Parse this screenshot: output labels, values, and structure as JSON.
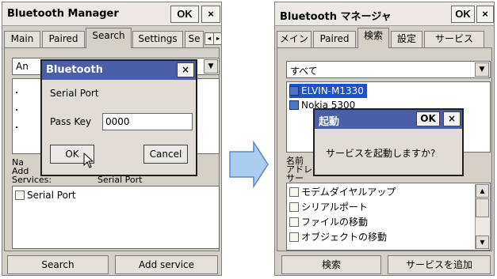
{
  "left": {
    "title": "Bluetooth Manager",
    "ok": "OK",
    "close": "×",
    "tabs": [
      "Main",
      "Paired",
      "Search",
      "Settings",
      "Se"
    ],
    "tab_scroll": [
      "◂",
      "▸"
    ],
    "filter_value": "An",
    "devices_hidden": true,
    "info": {
      "name_label": "Na",
      "address_label": "Add",
      "services_label": "Services:",
      "services_value": "Serial Port"
    },
    "services": [
      "Serial Port"
    ],
    "search_button": "Search",
    "add_service_button": "Add service",
    "dialog": {
      "title": "Bluetooth",
      "close": "×",
      "service": "Serial Port",
      "passkey_label": "Pass Key",
      "passkey_value": "0000",
      "ok": "OK",
      "cancel": "Cancel"
    }
  },
  "right": {
    "title": "Bluetooth マネージャ",
    "ok": "OK",
    "close": "×",
    "tabs": [
      "メイン",
      "Paired",
      "検索",
      "設定",
      "サービス"
    ],
    "filter_value": "すべて",
    "devices": [
      "ELVIN-M1330",
      "Nokia 5300"
    ],
    "info": {
      "name_label": "名前",
      "address_label": "アドレ",
      "services_label": "サー"
    },
    "services": [
      "モデムダイヤルアップ",
      "シリアルポート",
      "ファイルの移動",
      "オブジェクトの移動"
    ],
    "search_button": "検索",
    "add_service_button": "サービスを追加",
    "dialog": {
      "title": "起動",
      "ok": "OK",
      "close": "×",
      "message": "サービスを起動しますか?"
    }
  },
  "colors": {
    "accent": "#4a5fa8",
    "arrow": "#a8cdf0",
    "selection": "#1e50d0"
  },
  "icons": {
    "arrow": "right-arrow-icon",
    "cursor": "mouse-pointer-icon",
    "dropdown": "chevron-down-icon"
  }
}
